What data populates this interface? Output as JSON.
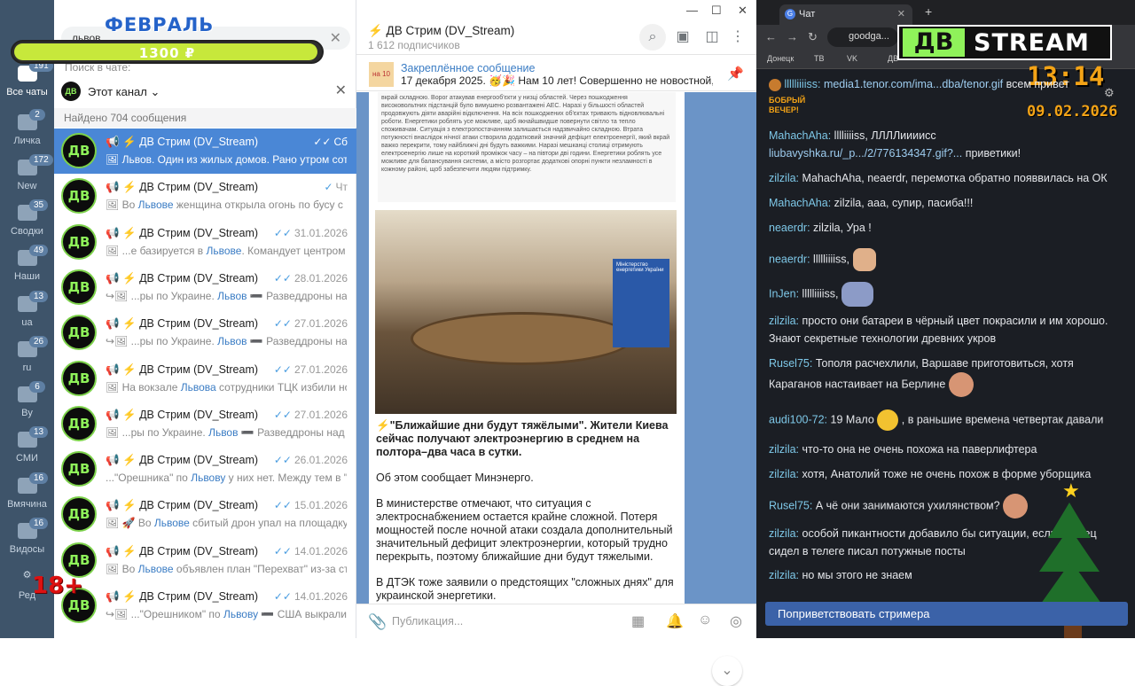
{
  "rail": {
    "items": [
      {
        "label": "Все чаты",
        "badge": "191"
      },
      {
        "label": "Личка",
        "badge": "2"
      },
      {
        "label": "New",
        "badge": "172"
      },
      {
        "label": "Сводки",
        "badge": "35"
      },
      {
        "label": "Наши",
        "badge": "49"
      },
      {
        "label": "ua",
        "badge": "13"
      },
      {
        "label": "ru",
        "badge": "26"
      },
      {
        "label": "By",
        "badge": "6"
      },
      {
        "label": "СМИ",
        "badge": "13"
      },
      {
        "label": "Вмячина",
        "badge": "16"
      },
      {
        "label": "Видосы",
        "badge": "16"
      },
      {
        "label": "Ред",
        "badge": ""
      }
    ]
  },
  "overlay": {
    "month": "ФЕВРАЛЬ",
    "goal_amount": "1300 ₽",
    "goal_progress": 0.98,
    "age_rating": "18+"
  },
  "list": {
    "search_query": "львов",
    "search_hint": "Поиск в чате:",
    "filter_label": "Этот канал",
    "found_label": "Найдено 704 сообщения",
    "avatar_text": "ДВ",
    "rows": [
      {
        "name": "📢 ⚡ ДВ Стрим (DV_Stream)",
        "date": "Сб",
        "check": "✓✓",
        "pre": "🖼 ",
        "hl": "Львов",
        "post": ". Один из жилых домов.  Рано утром сотр..."
      },
      {
        "name": "📢 ⚡ ДВ Стрим (DV_Stream)",
        "date": "Чт",
        "check": "✓",
        "pre": "🖼 Во ",
        "hl": "Львове",
        "post": " женщина открыла огонь по бусу с по..."
      },
      {
        "name": "📢 ⚡ ДВ Стрим (DV_Stream)",
        "date": "31.01.2026",
        "check": "✓✓",
        "pre": "🖼 ...е базируется в ",
        "hl": "Львове",
        "post": ". Командует центром по..."
      },
      {
        "name": "📢 ⚡ ДВ Стрим (DV_Stream)",
        "date": "28.01.2026",
        "check": "✓✓",
        "pre": "↪🖼 ...ры по Украине. ",
        "hl": "Львов",
        "post": " ➖ Разведдроны над..."
      },
      {
        "name": "📢 ⚡ ДВ Стрим (DV_Stream)",
        "date": "27.01.2026",
        "check": "✓✓",
        "pre": "↪🖼 ...ры по Украине. ",
        "hl": "Львов",
        "post": " ➖ Разведдроны над..."
      },
      {
        "name": "📢 ⚡ ДВ Стрим (DV_Stream)",
        "date": "27.01.2026",
        "check": "✓✓",
        "pre": "🖼 На вокзале ",
        "hl": "Львова",
        "post": " сотрудники ТЦК избили ног..."
      },
      {
        "name": "📢 ⚡ ДВ Стрим (DV_Stream)",
        "date": "27.01.2026",
        "check": "✓✓",
        "pre": "🖼 ...ры по Украине. ",
        "hl": "Львов",
        "post": " ➖ Разведдроны над К..."
      },
      {
        "name": "📢 ⚡ ДВ Стрим (DV_Stream)",
        "date": "26.01.2026",
        "check": "✓✓",
        "pre": "...\"Орешника\" по ",
        "hl": "Львову",
        "post": " у них нет.  Между тем в \"Е..."
      },
      {
        "name": "📢 ⚡ ДВ Стрим (DV_Stream)",
        "date": "15.01.2026",
        "check": "✓✓",
        "pre": "🖼 🚀 Во ",
        "hl": "Львове",
        "post": " сбитый дрон упал на площадку в..."
      },
      {
        "name": "📢 ⚡ ДВ Стрим (DV_Stream)",
        "date": "14.01.2026",
        "check": "✓✓",
        "pre": "🖼 Во ",
        "hl": "Львове",
        "post": " объявлен план \"Перехват\" из-за стре..."
      },
      {
        "name": "📢 ⚡ ДВ Стрим (DV_Stream)",
        "date": "14.01.2026",
        "check": "✓✓",
        "pre": "↪🖼 ...\"Орешником\" по ",
        "hl": "Львову",
        "post": " ➖ США выкрали ..."
      }
    ]
  },
  "chat": {
    "title": "⚡ ДВ Стрим (DV_Stream)",
    "subscribers": "1 612 подписчиков",
    "pinned_title": "Закреплённое сообщение",
    "pinned_text": "17 декабря 2025. 🥳🎉 Нам 10 лет! Совершенно не новостной, н...",
    "pinned_thumb": "на 10 лет",
    "scan_text": "вкрай складною. Ворог атакував енергооб'єкти у низці областей. Через пошкодження високовольтних підстанцій було вимушено розвантажені АЕС. Наразі у більшості областей продовжують діяти аварійні відключення. На всіх пошкоджених об'єктах тривають відновлювальні роботи. Енергетики роблять усе можливе, щоб якнайшвидше повернути світло та тепло споживачам. Ситуація з електропостачанням залишається надзвичайно складною. Втрата потужності внаслідок нічної атаки створила додатковий значний дефіцит електроенергії, який вкрай важко перекрити, тому найближчі дні будуть важкими. Наразі мешканці столиці отримують електроенергію лише на короткий проміжок часу – на півтори дві години. Енергетики роблять усе можливе для балансування системи, а місто розгортає додаткові опорні пункти незламності в кожному районі, щоб забезпечити людям підтримку.",
    "photo_sign": "Міністерство енергетики України",
    "headline": "⚡\"Ближайшие дни будут тяжёлыми\". Жители Киева сейчас получают электроэнергию в среднем на полтора–два часа в сутки.",
    "p1": "Об этом сообщает Минэнерго.",
    "p2": "В министерстве отмечают, что ситуация с электроснабжением остается крайне сложной. Потеря мощностей после ночной атаки создала дополнительный значительный дефицит электроэнергии, который трудно перекрыть, поэтому ближайшие дни будут тяжелыми.",
    "p3": "В ДТЭК тоже заявили о предстоящих \"сложных днях\" для украинской энергетики.",
    "composer_placeholder": "Публикация..."
  },
  "browser": {
    "tab_title": "Чат",
    "url": "goodga...",
    "bookmarks": [
      "Донецк",
      "ТВ",
      "VK",
      "ДВ"
    ]
  },
  "stream": {
    "logo_left": "ДВ",
    "logo_right": "STREAM",
    "clock": "13:14",
    "date": "09.02.2026",
    "greet_button": "Поприветствовать стримера",
    "badge_text": "БОБРЫЙ ВЕЧЕР!",
    "messages": [
      {
        "user": "llllliiiiss:",
        "text": "всем привет",
        "link": "media1.tenor.com/ima...dba/tenor.gif"
      },
      {
        "user": "MahachAha:",
        "text": "lllliiiiss, ЛЛЛЛииииcc"
      },
      {
        "user": "",
        "text": "приветики!",
        "link": "liubavyshka.ru/_p.../2/776134347.gif?..."
      },
      {
        "user": "zilzila:",
        "text": "MahachAha, neaerdr, перемотка обратно появвилась на ОК"
      },
      {
        "user": "MahachAha:",
        "text": "zilzila, ааа, супир, пасиба!!!"
      },
      {
        "user": "neaerdr:",
        "text": "zilzila, Ура !"
      },
      {
        "user": "neaerdr:",
        "text": "llllliiiiss,"
      },
      {
        "user": "InJen:",
        "text": "llllliiiiss,"
      },
      {
        "user": "zilzila:",
        "text": "просто они батареи в чёрный цвет покрасили и им хорошо. Знают секретные технологии древних укров"
      },
      {
        "user": "Rusel75:",
        "text": "Тополя расчехлили, Варшаве приготовиться, хотя Караганов настаивает на Берлине"
      },
      {
        "user": "audi100-72:",
        "text": "19 Мало",
        "text2": ", в раньшие времена четвертак давали"
      },
      {
        "user": "zilzila:",
        "text": "что-то она не очень похожа на паверлифтера"
      },
      {
        "user": "zilzila:",
        "text": "хотя, Анатолий тоже не очень похож в форме уборщика"
      },
      {
        "user": "Rusel75:",
        "text": "А чё они занимаются ухилянством?"
      },
      {
        "user": "zilzila:",
        "text": "особой пикантности добавило бы ситуации, если хлопец сидел в телеге писал потужные посты"
      },
      {
        "user": "zilzila:",
        "text": "но мы этого не знаем"
      }
    ]
  },
  "colors": {
    "rail_bg": "#3e546a",
    "selected_row": "#4a87d6",
    "chat_bg": "#6b94c7",
    "stream_bg": "#1b1e24",
    "accent_green": "#8ff25a",
    "clock_orange": "#f3a316"
  }
}
